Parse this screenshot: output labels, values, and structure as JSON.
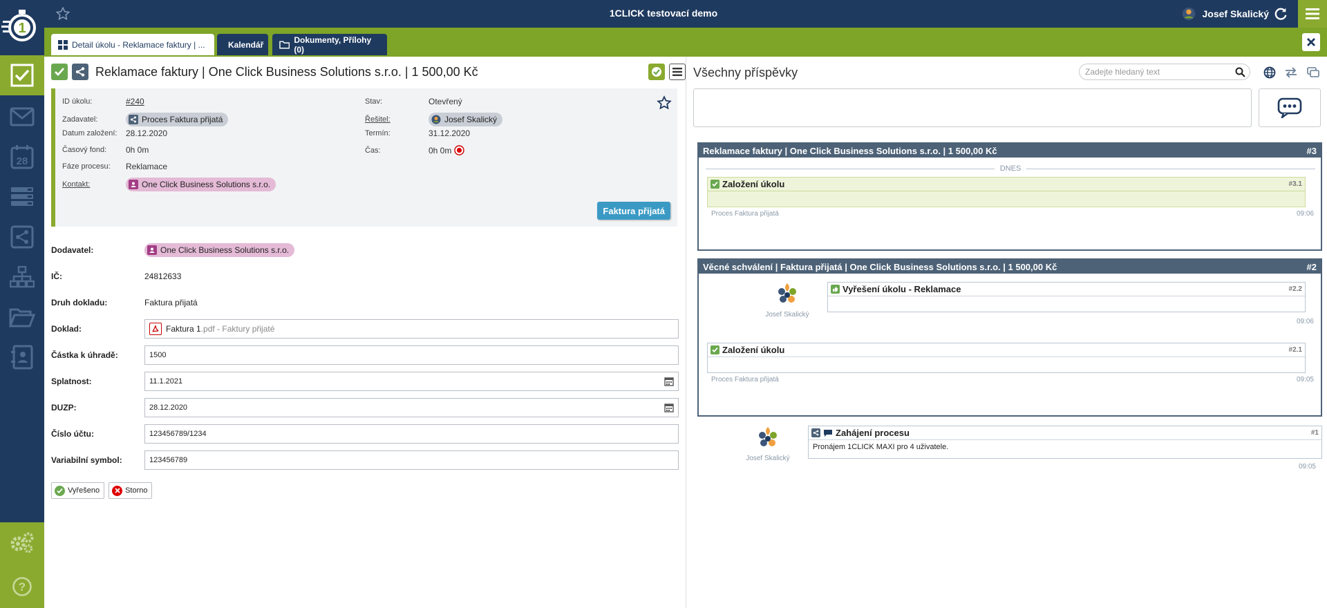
{
  "app": {
    "title": "1CLICK testovací demo",
    "user": "Josef Skalický"
  },
  "tabs": [
    {
      "label": "Detail úkolu - Reklamace faktury | ..."
    },
    {
      "label": "Kalendář"
    },
    {
      "label": "Dokumenty, Přílohy (0)"
    }
  ],
  "task": {
    "title": "Reklamace faktury | One Click Business Solutions s.r.o. | 1 500,00 Kč",
    "info": {
      "id_label": "ID úkolu:",
      "id_value": "#240",
      "zadavatel_label": "Zadavatel:",
      "zadavatel_value": "Proces Faktura přijatá",
      "datum_label": "Datum založení:",
      "datum_value": "28.12.2020",
      "fond_label": "Časový fond:",
      "fond_value": "0h 0m",
      "faze_label": "Fáze procesu:",
      "faze_value": "Reklamace",
      "kontakt_label": "Kontakt:",
      "kontakt_value": "One Click Business Solutions s.r.o.",
      "stav_label": "Stav:",
      "stav_value": "Otevřený",
      "resitel_label": "Řešitel:",
      "resitel_value": "Josef Skalický",
      "termin_label": "Termín:",
      "termin_value": "31.12.2020",
      "cas_label": "Čas:",
      "cas_value": "0h 0m"
    },
    "faktura_button": "Faktura přijatá",
    "form": {
      "dodavatel_label": "Dodavatel:",
      "dodavatel_value": "One Click Business Solutions s.r.o.",
      "ic_label": "IČ:",
      "ic_value": "24812633",
      "druh_label": "Druh dokladu:",
      "druh_value": "Faktura přijatá",
      "doklad_label": "Doklad:",
      "doklad_name": "Faktura 1",
      "doklad_ext": ".pdf - Faktury přijaté",
      "castka_label": "Částka k úhradě:",
      "castka_value": "1500",
      "splatnost_label": "Splatnost:",
      "splatnost_value": "11.1.2021",
      "duzp_label": "DUZP:",
      "duzp_value": "28.12.2020",
      "ucet_label": "Číslo účtu:",
      "ucet_value": "123456789/1234",
      "vs_label": "Variabilní symbol:",
      "vs_value": "123456789"
    },
    "actions": {
      "resolved": "Vyřešeno",
      "cancel": "Storno"
    }
  },
  "feed": {
    "title": "Všechny příspěvky",
    "search_placeholder": "Zadejte hledaný text",
    "threads": [
      {
        "title": "Reklamace faktury | One Click Business Solutions s.r.o. | 1 500,00 Kč",
        "num": "#3",
        "separator": "DNES",
        "posts": [
          {
            "title": "Založení úkolu",
            "num": "#3.1",
            "meta": "Proces Faktura přijatá",
            "time": "09:06"
          }
        ]
      },
      {
        "title": "Věcné schválení | Faktura přijatá | One Click Business Solutions s.r.o. | 1 500,00 Kč",
        "num": "#2",
        "posts": [
          {
            "title": "Vyřešení úkolu - Reklamace",
            "num": "#2.2",
            "author": "Josef Skalický",
            "time": "09:06"
          },
          {
            "title": "Založení úkolu",
            "num": "#2.1",
            "meta": "Proces Faktura přijatá",
            "time": "09:05"
          }
        ]
      }
    ],
    "standalone": {
      "title": "Zahájení procesu",
      "num": "#1",
      "author": "Josef Skalický",
      "body": "Pronájem 1CLICK MAXI pro 4 uživatele.",
      "time": "09:05"
    }
  },
  "colors": {
    "navy": "#1f3a5f",
    "green": "#8aaa2f",
    "thread": "#4d6277",
    "blue_button": "#3a9ac4"
  }
}
